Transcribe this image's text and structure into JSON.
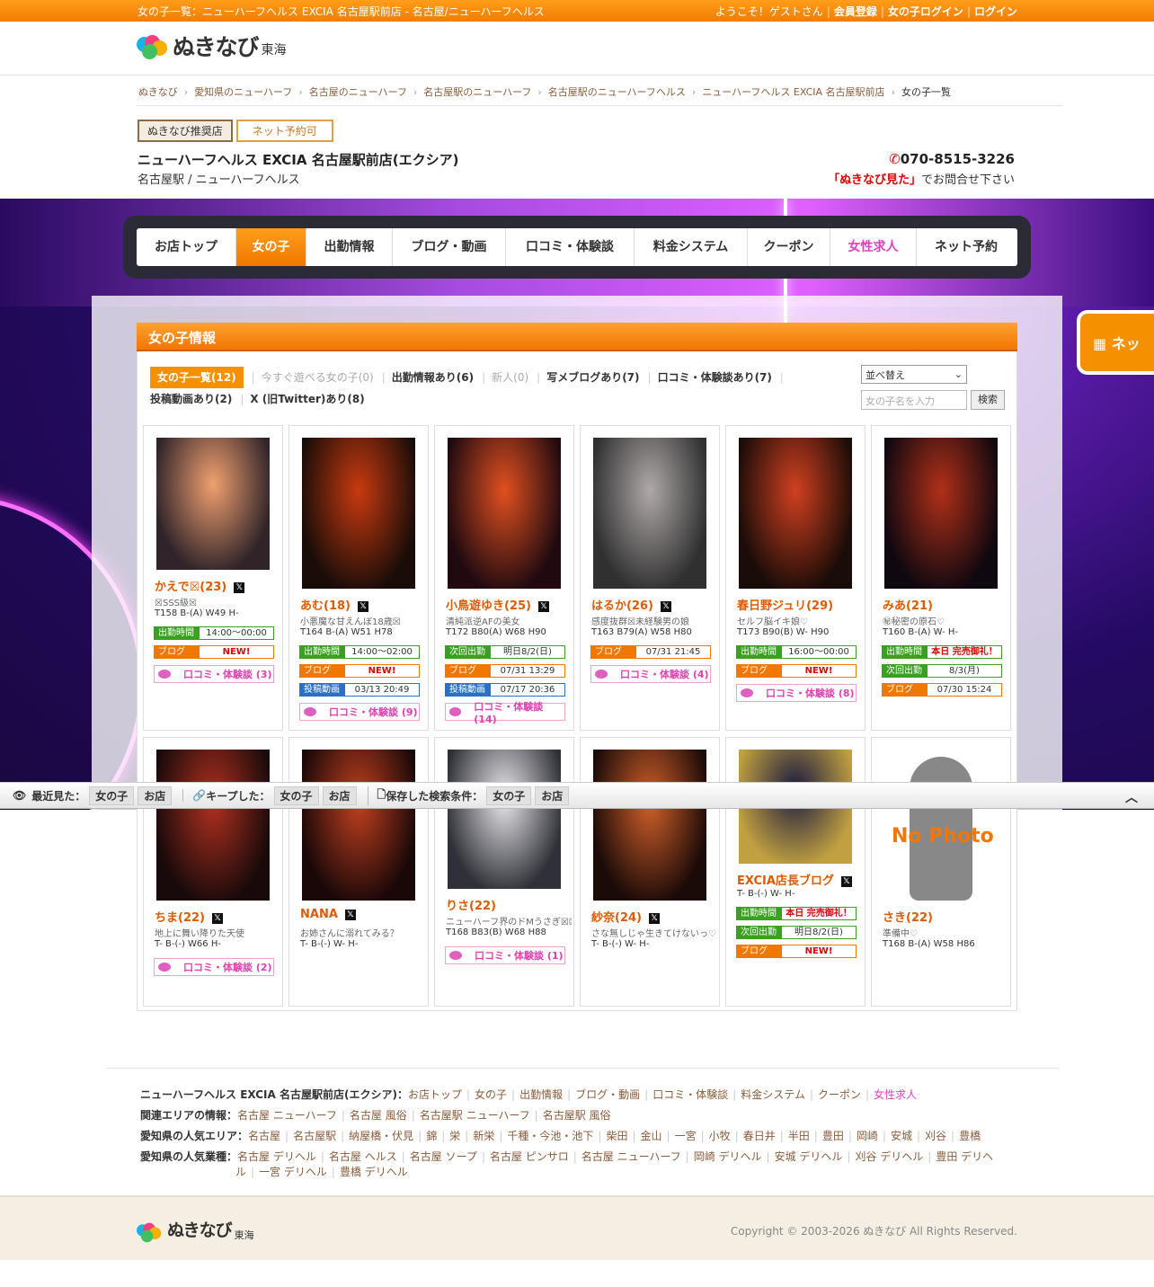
{
  "topbar": {
    "title": "女の子一覧：ニューハーフヘルス EXCIA 名古屋駅前店 - 名古屋/ニューハーフヘルス",
    "welcome": "ようこそ！ゲストさん",
    "register": "会員登録",
    "girl_login": "女の子ログイン",
    "login": "ログイン"
  },
  "logo": {
    "text": "ぬきなび",
    "sub": "東海"
  },
  "breadcrumb": [
    "ぬきなび",
    "愛知県のニューハーフ",
    "名古屋のニューハーフ",
    "名古屋駅のニューハーフ",
    "名古屋駅のニューハーフヘルス",
    "ニューハーフヘルス EXCIA 名古屋駅前店",
    "女の子一覧"
  ],
  "shop": {
    "badge1": "ぬきなび推奨店",
    "badge2": "ネット予約可",
    "name": "ニューハーフヘルス EXCIA 名古屋駅前店(エクシア)",
    "area": "名古屋駅 / ニューハーフヘルス",
    "tel": "070-8515-3226",
    "tel_note_hl": "「ぬきなび見た」",
    "tel_note": "でお問合せ下さい"
  },
  "nav": [
    "お店トップ",
    "女の子",
    "出勤情報",
    "ブログ・動画",
    "口コミ・体験談",
    "料金システム",
    "クーポン",
    "女性求人",
    "ネット予約"
  ],
  "section_title": "女の子情報",
  "filters": [
    "女の子一覧(12)",
    "今すぐ遊べる女の子(0)",
    "出勤情報あり(6)",
    "新人(0)",
    "写メブログあり(7)",
    "口コミ・体験談あり(7)",
    "投稿動画あり(2)",
    "X (旧Twitter)あり(8)"
  ],
  "sort": {
    "label": "並べ替え",
    "placeholder": "女の子名を入力",
    "button": "検索"
  },
  "cards": [
    {
      "name": "かえで☒(23)",
      "catch": "☒SSS級☒",
      "spec": "T158 B-(A) W49 H-",
      "rows": [
        [
          "出勤時間",
          "14:00〜00:00"
        ],
        [
          "ブログ",
          "NEW!"
        ]
      ],
      "review": "口コミ・体験談 (3)"
    },
    {
      "name": "あむ(18)",
      "catch": "小悪魔な甘えんぼ18歳☒",
      "spec": "T164 B-(A) W51 H78",
      "rows": [
        [
          "出勤時間",
          "14:00〜02:00"
        ],
        [
          "ブログ",
          "NEW!"
        ],
        [
          "投稿動画",
          "03/13 20:49"
        ]
      ],
      "review": "口コミ・体験談 (9)"
    },
    {
      "name": "小鳥遊ゆき(25)",
      "catch": "清純派逆AFの美女",
      "spec": "T172 B80(A) W68 H90",
      "rows": [
        [
          "次回出勤",
          "明日8/2(日)"
        ],
        [
          "ブログ",
          "07/31 13:29"
        ],
        [
          "投稿動画",
          "07/17 20:36"
        ]
      ],
      "review": "口コミ・体験談 (14)"
    },
    {
      "name": "はるか(26)",
      "catch": "感度抜群☒未経験男の娘",
      "spec": "T163 B79(A) W58 H80",
      "rows": [
        [
          "ブログ",
          "07/31 21:45"
        ]
      ],
      "review": "口コミ・体験談 (4)"
    },
    {
      "name": "春日野ジュリ(29)",
      "catch": "セルフ脳イキ娘♡",
      "spec": "T173 B90(B) W- H90",
      "rows": [
        [
          "出勤時間",
          "16:00〜00:00"
        ],
        [
          "ブログ",
          "NEW!"
        ]
      ],
      "review": "口コミ・体験談 (8)"
    },
    {
      "name": "みあ(21)",
      "catch": "㊙秘密の原石♡",
      "spec": "T160 B-(A) W- H-",
      "rows": [
        [
          "出勤時間",
          "本日 完売御礼！"
        ],
        [
          "次回出勤",
          "8/3(月)"
        ],
        [
          "ブログ",
          "07/30 15:24"
        ]
      ],
      "review": ""
    },
    {
      "name": "ちま(22)",
      "catch": "地上に舞い降りた天使",
      "spec": "T- B-(-) W66 H-",
      "rows": [],
      "review": "口コミ・体験談 (2)"
    },
    {
      "name": "NANA",
      "catch": "お姉さんに溺れてみる？",
      "spec": "T- B-(-) W- H-",
      "rows": [],
      "review": ""
    },
    {
      "name": "りさ(22)",
      "catch": "ニューハーフ界のドMうさぎ☒☒",
      "spec": "T168 B83(B) W68 H88",
      "rows": [],
      "review": "口コミ・体験談 (1)"
    },
    {
      "name": "紗奈(24)",
      "catch": "さな無しじゃ生きてけないっ♡",
      "spec": "T- B-(-) W- H-",
      "rows": [],
      "review": ""
    },
    {
      "name": "EXCIA店長ブログ",
      "catch": "",
      "spec": "T- B-(-) W- H-",
      "rows": [
        [
          "出勤時間",
          "本日 完売御礼！"
        ],
        [
          "次回出勤",
          "明日8/2(日)"
        ],
        [
          "ブログ",
          "NEW!"
        ]
      ],
      "review": ""
    },
    {
      "name": "さき(22)",
      "catch": "準備中♡",
      "spec": "T168 B-(A) W58 H86",
      "rows": [],
      "review": "",
      "nophoto": "No Photo"
    }
  ],
  "recent": {
    "seen": "最近見た：",
    "keep": "キープした：",
    "saved": "保存した検索条件：",
    "girl": "女の子",
    "shop": "お店"
  },
  "fixed_button": "ネッ",
  "footer": {
    "shop_label": "ニューハーフヘルス EXCIA 名古屋駅前店(エクシア)：",
    "shop_links": [
      "お店トップ",
      "女の子",
      "出勤情報",
      "ブログ・動画",
      "口コミ・体験談",
      "料金システム",
      "クーポン",
      "女性求人"
    ],
    "area_label": "関連エリアの情報：",
    "area_links": [
      "名古屋 ニューハーフ",
      "名古屋 風俗",
      "名古屋駅 ニューハーフ",
      "名古屋駅 風俗"
    ],
    "pop_area_label": "愛知県の人気エリア：",
    "pop_area_links": [
      "名古屋",
      "名古屋駅",
      "納屋橋・伏見",
      "錦",
      "栄",
      "新栄",
      "千種・今池・池下",
      "柴田",
      "金山",
      "一宮",
      "小牧",
      "春日井",
      "半田",
      "豊田",
      "岡崎",
      "安城",
      "刈谷",
      "豊橋"
    ],
    "pop_type_label": "愛知県の人気業種：",
    "pop_type_links": [
      "名古屋 デリヘル",
      "名古屋 ヘルス",
      "名古屋 ソープ",
      "名古屋 ピンサロ",
      "名古屋 ニューハーフ",
      "岡崎 デリヘル",
      "安城 デリヘル",
      "刈谷 デリヘル",
      "豊田 デリヘル",
      "一宮 デリヘル",
      "豊橋 デリヘル"
    ],
    "copyright": "Copyright © 2003-2026 ぬきなび All Rights Reserved."
  }
}
